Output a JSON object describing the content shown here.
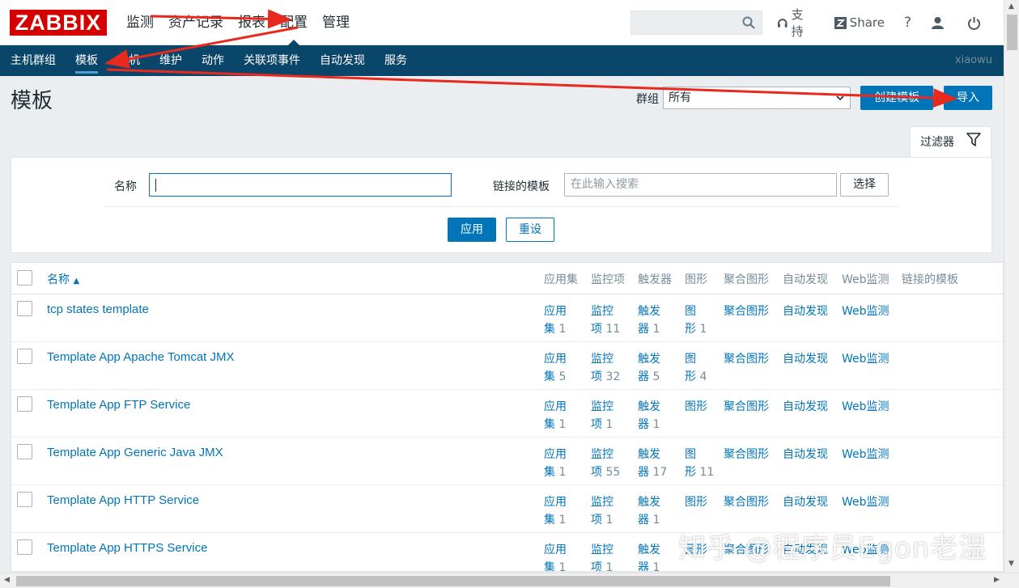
{
  "header": {
    "logo": "ZABBIX",
    "nav": [
      "监测",
      "资产记录",
      "报表",
      "配置",
      "管理"
    ],
    "active_nav": "配置",
    "search_placeholder": "",
    "support": "支持",
    "share": "Share",
    "help": "?"
  },
  "subnav": {
    "items": [
      "主机群组",
      "模板",
      "主机",
      "维护",
      "动作",
      "关联项事件",
      "自动发现",
      "服务"
    ],
    "active": "模板",
    "user": "xiaowu"
  },
  "page": {
    "title": "模板",
    "group_label": "群组",
    "group_value": "所有",
    "create_button": "创建模板",
    "import_button": "导入"
  },
  "filter": {
    "tab_label": "过滤器",
    "name_label": "名称",
    "name_value": "",
    "linked_label": "链接的模板",
    "linked_placeholder": "在此输入搜索",
    "select_button": "选择",
    "apply_button": "应用",
    "reset_button": "重设"
  },
  "table": {
    "columns": [
      "名称",
      "应用集",
      "监控项",
      "触发器",
      "图形",
      "聚合图形",
      "自动发现",
      "Web监测",
      "链接的模板"
    ],
    "sort_indicator": "▲",
    "rows": [
      {
        "name": "tcp states template",
        "apps": [
          "应用",
          "集",
          "1"
        ],
        "items": [
          "监控",
          "项",
          "11"
        ],
        "triggers": [
          "触发",
          "器",
          "1"
        ],
        "graphs": [
          "图",
          "形",
          "1"
        ],
        "screens": "聚合图形",
        "discovery": "自动发现",
        "web": "Web监测"
      },
      {
        "name": "Template App Apache Tomcat JMX",
        "apps": [
          "应用",
          "集",
          "5"
        ],
        "items": [
          "监控",
          "项",
          "32"
        ],
        "triggers": [
          "触发",
          "器",
          "5"
        ],
        "graphs": [
          "图",
          "形",
          "4"
        ],
        "screens": "聚合图形",
        "discovery": "自动发现",
        "web": "Web监测"
      },
      {
        "name": "Template App FTP Service",
        "apps": [
          "应用",
          "集",
          "1"
        ],
        "items": [
          "监控",
          "项",
          "1"
        ],
        "triggers": [
          "触发",
          "器",
          "1"
        ],
        "graphs": [
          "图形",
          "",
          ""
        ],
        "screens": "聚合图形",
        "discovery": "自动发现",
        "web": "Web监测"
      },
      {
        "name": "Template App Generic Java JMX",
        "apps": [
          "应用",
          "集",
          "1"
        ],
        "items": [
          "监控",
          "项",
          "55"
        ],
        "triggers": [
          "触发",
          "器",
          "17"
        ],
        "graphs": [
          "图",
          "形",
          "11"
        ],
        "screens": "聚合图形",
        "discovery": "自动发现",
        "web": "Web监测"
      },
      {
        "name": "Template App HTTP Service",
        "apps": [
          "应用",
          "集",
          "1"
        ],
        "items": [
          "监控",
          "项",
          "1"
        ],
        "triggers": [
          "触发",
          "器",
          "1"
        ],
        "graphs": [
          "图形",
          "",
          ""
        ],
        "screens": "聚合图形",
        "discovery": "自动发现",
        "web": "Web监测"
      },
      {
        "name": "Template App HTTPS Service",
        "apps": [
          "应用",
          "集",
          "1"
        ],
        "items": [
          "监控",
          "项",
          "1"
        ],
        "triggers": [
          "触发",
          "器",
          "1"
        ],
        "graphs": [
          "图形",
          "",
          ""
        ],
        "screens": "聚合图形",
        "discovery": "自动发现",
        "web": "Web监测"
      }
    ]
  },
  "watermark": "知乎 @程序员Egon老湿",
  "colors": {
    "brand_red": "#d40000",
    "subnav_bg": "#0a466a",
    "link": "#0275b8",
    "arrow": "#e8291e"
  }
}
